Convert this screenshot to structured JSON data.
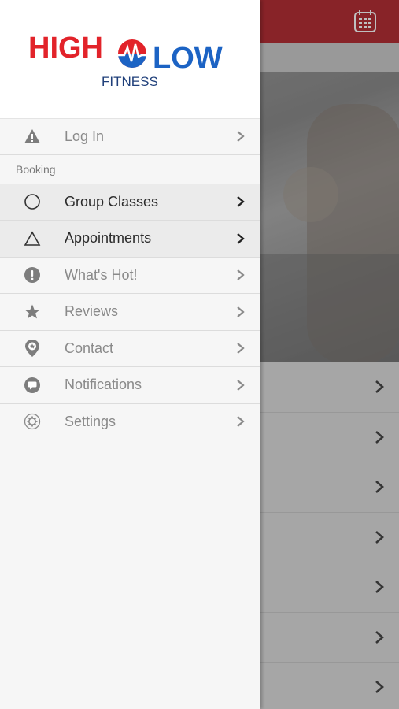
{
  "brand": {
    "logo_word_left": "HIGH",
    "logo_word_right": "LOW",
    "logo_sub": "FITNESS",
    "colors": {
      "red": "#e2232a",
      "blue": "#1c63c4",
      "navy": "#1f3f7a"
    }
  },
  "header": {
    "calendar_icon": "calendar-icon",
    "bar_color": "#a51a20"
  },
  "menu": {
    "login": {
      "label": "Log In",
      "icon": "warning-icon"
    },
    "section_label": "Booking",
    "items": [
      {
        "label": "Group Classes",
        "icon": "circle-icon",
        "active": true
      },
      {
        "label": "Appointments",
        "icon": "triangle-icon",
        "active": true
      },
      {
        "label": "What's Hot!",
        "icon": "exclamation-icon",
        "active": false
      },
      {
        "label": "Reviews",
        "icon": "star-icon",
        "active": false
      },
      {
        "label": "Contact",
        "icon": "location-pin-icon",
        "active": false
      },
      {
        "label": "Notifications",
        "icon": "chat-bubble-icon",
        "active": false
      },
      {
        "label": "Settings",
        "icon": "gear-icon",
        "active": false
      }
    ]
  }
}
